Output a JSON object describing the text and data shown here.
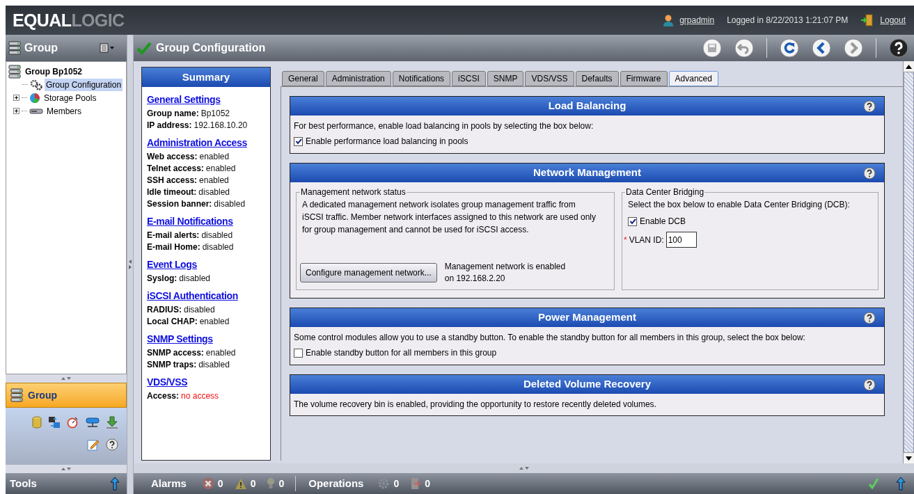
{
  "header": {
    "brand_strong": "EQUAL",
    "brand_light": "LOGIC",
    "user": "grpadmin",
    "login_info": "Logged in 8/22/2013 1:21:07 PM",
    "logout": "Logout"
  },
  "nav_panel": {
    "title": "Group",
    "tree": [
      {
        "label": "Group Bp1052",
        "kind": "group",
        "selected": false,
        "children": [
          {
            "label": "Group Configuration",
            "kind": "config",
            "selected": true
          },
          {
            "label": "Storage Pools",
            "kind": "pools",
            "selected": false,
            "expanded": false
          },
          {
            "label": "Members",
            "kind": "members",
            "selected": false,
            "expanded": false
          }
        ]
      }
    ]
  },
  "group_panel": {
    "title": "Group"
  },
  "tools_bar": {
    "title": "Tools"
  },
  "page": {
    "title": "Group Configuration"
  },
  "summary": {
    "title": "Summary",
    "sections": [
      {
        "heading": "General Settings",
        "rows": [
          {
            "label": "Group name:",
            "value": "Bp1052",
            "alert": false
          },
          {
            "label": "IP address:",
            "value": "192.168.10.20",
            "alert": false
          }
        ]
      },
      {
        "heading": "Administration Access",
        "rows": [
          {
            "label": "Web access:",
            "value": "enabled",
            "alert": false
          },
          {
            "label": "Telnet access:",
            "value": "enabled",
            "alert": false
          },
          {
            "label": "SSH access:",
            "value": "enabled",
            "alert": false
          },
          {
            "label": "Idle timeout:",
            "value": "disabled",
            "alert": false
          },
          {
            "label": "Session banner:",
            "value": "disabled",
            "alert": false
          }
        ]
      },
      {
        "heading": "E-mail Notifications",
        "rows": [
          {
            "label": "E-mail alerts:",
            "value": "disabled",
            "alert": false
          },
          {
            "label": "E-mail Home:",
            "value": "disabled",
            "alert": false
          }
        ]
      },
      {
        "heading": "Event Logs",
        "rows": [
          {
            "label": "Syslog:",
            "value": "disabled",
            "alert": false
          }
        ]
      },
      {
        "heading": "iSCSI Authentication",
        "rows": [
          {
            "label": "RADIUS:",
            "value": "disabled",
            "alert": false
          },
          {
            "label": "Local CHAP:",
            "value": "enabled",
            "alert": false
          }
        ]
      },
      {
        "heading": "SNMP Settings",
        "rows": [
          {
            "label": "SNMP access:",
            "value": "enabled",
            "alert": false
          },
          {
            "label": "SNMP traps:",
            "value": "disabled",
            "alert": false
          }
        ]
      },
      {
        "heading": "VDS/VSS",
        "rows": [
          {
            "label": "Access:",
            "value": "no access",
            "alert": true
          }
        ]
      }
    ]
  },
  "tabs": [
    {
      "label": "General",
      "selected": false
    },
    {
      "label": "Administration",
      "selected": false
    },
    {
      "label": "Notifications",
      "selected": false
    },
    {
      "label": "iSCSI",
      "selected": false
    },
    {
      "label": "SNMP",
      "selected": false
    },
    {
      "label": "VDS/VSS",
      "selected": false
    },
    {
      "label": "Defaults",
      "selected": false
    },
    {
      "label": "Firmware",
      "selected": false
    },
    {
      "label": "Advanced",
      "selected": true
    }
  ],
  "sections": [
    {
      "kind": "checkbox",
      "title": "Load Balancing",
      "text": "For best performance, enable load balancing in pools by selecting the box below:",
      "checkbox": {
        "label": "Enable performance load balancing in pools",
        "checked": true
      }
    },
    {
      "kind": "network",
      "title": "Network Management",
      "status_group": {
        "legend": "Management network status",
        "text": "A dedicated management network isolates group management traffic from iSCSI traffic. Member network interfaces assigned to this network are used only for group management and cannot be used for iSCSI access.",
        "button": "Configure management network...",
        "status_line_1": "Management network is enabled",
        "status_line_2": "on 192.168.2.20"
      },
      "dcb_group": {
        "legend": "Data Center Bridging",
        "text": "Select the box below to enable Data Center Bridging (DCB):",
        "checkbox": {
          "label": "Enable DCB",
          "checked": true
        },
        "required_mark": "*",
        "vlan_label": "VLAN ID:",
        "vlan_value": "100"
      }
    },
    {
      "kind": "checkbox",
      "title": "Power Management",
      "text": "Some control modules allow you to use a standby button. To enable the standby button for all members in this group, select the box below:",
      "checkbox": {
        "label": "Enable standby button for all members in this group",
        "checked": false
      }
    },
    {
      "kind": "text",
      "title": "Deleted Volume Recovery",
      "text": "The volume recovery bin is enabled, providing the opportunity to restore recently deleted volumes."
    }
  ],
  "status_bar": {
    "alarms_label": "Alarms",
    "alarms": [
      {
        "kind": "error",
        "count": "0"
      },
      {
        "kind": "warning",
        "count": "0"
      },
      {
        "kind": "info",
        "count": "0"
      }
    ],
    "operations_label": "Operations",
    "operations": [
      {
        "kind": "gear",
        "count": "0"
      },
      {
        "kind": "pending",
        "count": "0"
      }
    ]
  }
}
